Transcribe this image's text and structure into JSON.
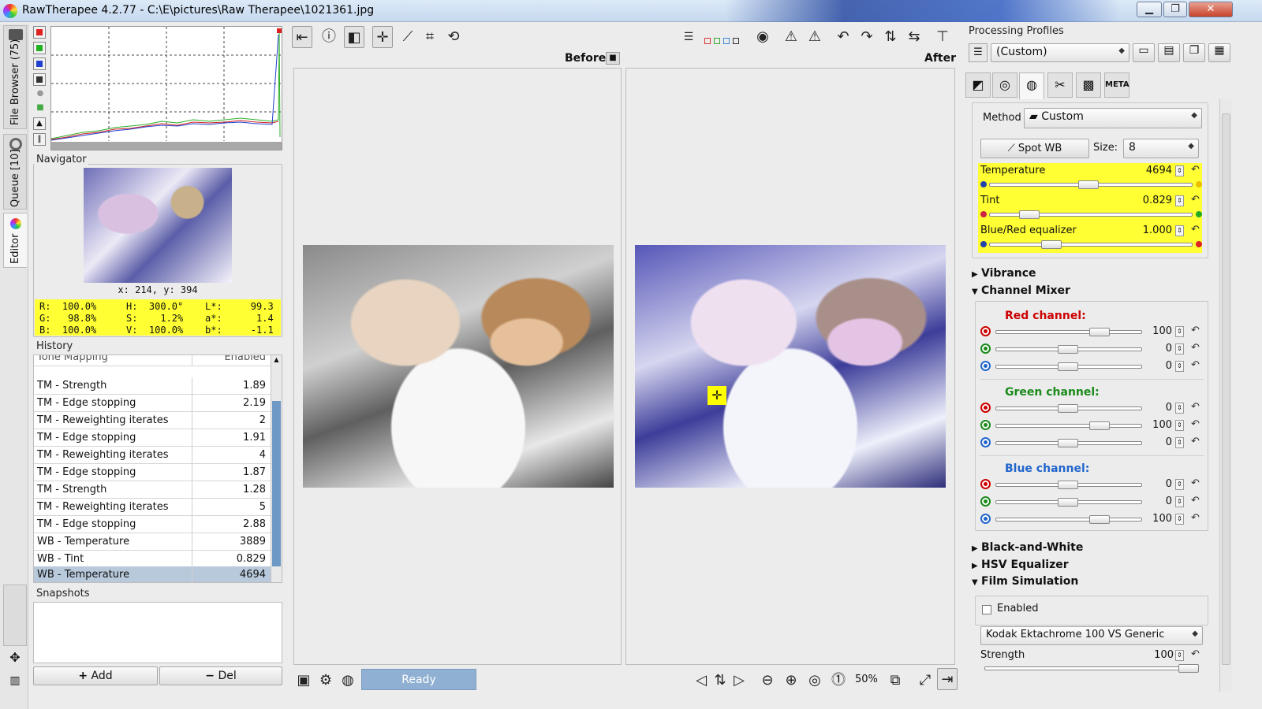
{
  "window": {
    "title": "RawTherapee 4.2.77 - C:\\E\\pictures\\Raw Therapee\\1021361.jpg",
    "minimize": "▁",
    "maximize": "❐",
    "close": "✕"
  },
  "left_tabs": {
    "file_browser": "File Browser (75)",
    "queue": "Queue [10]",
    "editor": "Editor"
  },
  "navigator": {
    "label": "Navigator",
    "coords": "x: 214, y: 394",
    "rgb": [
      "R:  100.0%",
      "G:   98.8%",
      "B:  100.0%"
    ],
    "hsv": [
      "H:  300.0°",
      "S:    1.2%",
      "V:  100.0%"
    ],
    "lab": [
      "L*:     99.3",
      "a*:      1.4",
      "b*:     -1.1"
    ]
  },
  "history": {
    "label": "History",
    "partial": {
      "name": "Tone Mapping",
      "value": "Enabled"
    },
    "rows": [
      {
        "name": "TM - Strength",
        "value": "1.89"
      },
      {
        "name": "TM - Edge stopping",
        "value": "2.19"
      },
      {
        "name": "TM - Reweighting iterates",
        "value": "2"
      },
      {
        "name": "TM - Edge stopping",
        "value": "1.91"
      },
      {
        "name": "TM - Reweighting iterates",
        "value": "4"
      },
      {
        "name": "TM - Edge stopping",
        "value": "1.87"
      },
      {
        "name": "TM - Strength",
        "value": "1.28"
      },
      {
        "name": "TM - Reweighting iterates",
        "value": "5"
      },
      {
        "name": "TM - Edge stopping",
        "value": "2.88"
      },
      {
        "name": "WB - Temperature",
        "value": "3889"
      },
      {
        "name": "WB - Tint",
        "value": "0.829"
      },
      {
        "name": "WB - Temperature",
        "value": "4694"
      }
    ]
  },
  "snapshots": {
    "label": "Snapshots",
    "add": "Add",
    "del": "Del"
  },
  "preview": {
    "before": "Before",
    "after": "After"
  },
  "status": {
    "ready": "Ready",
    "zoom": "50%"
  },
  "profiles": {
    "label": "Processing Profiles",
    "value": "(Custom)"
  },
  "white_balance": {
    "method_label": "Method",
    "method_value": "Custom",
    "spot_wb": "Spot WB",
    "size_label": "Size:",
    "size_value": "8",
    "temperature": {
      "label": "Temperature",
      "value": "4694"
    },
    "tint": {
      "label": "Tint",
      "value": "0.829"
    },
    "equalizer": {
      "label": "Blue/Red equalizer",
      "value": "1.000"
    }
  },
  "sections": {
    "vibrance": "Vibrance",
    "channel_mixer": "Channel Mixer",
    "black_white": "Black-and-White",
    "hsv_eq": "HSV Equalizer",
    "film_sim": "Film Simulation"
  },
  "channel_mixer": {
    "red": {
      "label": "Red channel:",
      "values": [
        "100",
        "0",
        "0"
      ]
    },
    "green": {
      "label": "Green channel:",
      "values": [
        "0",
        "100",
        "0"
      ]
    },
    "blue": {
      "label": "Blue channel:",
      "values": [
        "0",
        "0",
        "100"
      ]
    }
  },
  "film_simulation": {
    "enabled_label": "Enabled",
    "film": "Kodak Ektachrome 100 VS Generic",
    "strength_label": "Strength",
    "strength_value": "100"
  },
  "colors": {
    "highlight": "#ffff33",
    "selection": "#b8c9dc",
    "ready": "#8fb0d2",
    "red_ch": "#cc0000",
    "green_ch": "#1a8a1a",
    "blue_ch": "#2266cc"
  }
}
